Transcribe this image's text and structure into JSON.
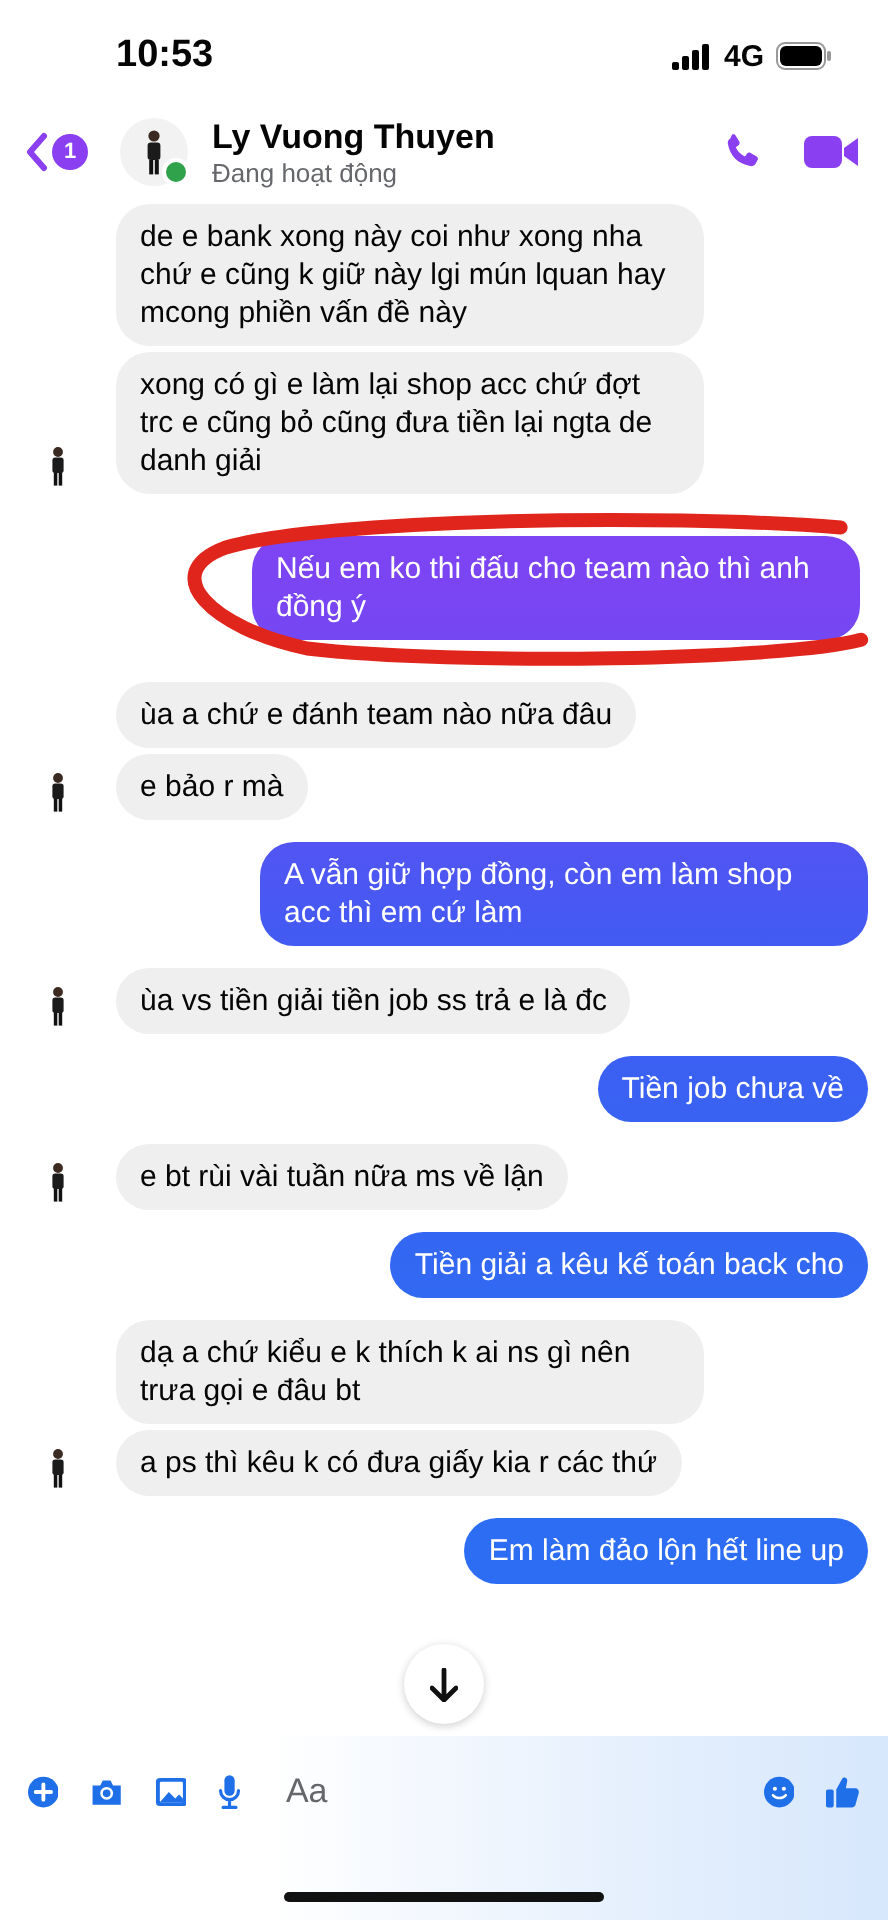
{
  "status_bar": {
    "time": "10:53",
    "network": "4G"
  },
  "header": {
    "back_badge": "1",
    "name": "Ly Vuong Thuyen",
    "status": "Đang hoạt động",
    "online": true
  },
  "messages": [
    {
      "kind": "incoming",
      "text": "de e bank xong này coi như xong nha chứ e cũng k giữ này lgi mún lquan hay mcong phiền vấn đề này",
      "avatar": false,
      "circled": false
    },
    {
      "kind": "incoming",
      "text": "xong có gì e làm lại shop acc chứ đợt trc e cũng bỏ cũng đưa tiền lại ngta de danh giải",
      "avatar": true,
      "circled": false
    },
    {
      "kind": "outgoing",
      "text": "Nếu em ko thi đấu cho team nào thì anh đồng ý",
      "avatar": false,
      "circled": true
    },
    {
      "kind": "incoming",
      "text": "ùa a chứ e đánh team nào nữa đâu",
      "avatar": false,
      "circled": false
    },
    {
      "kind": "incoming",
      "text": "e bảo r mà",
      "avatar": true,
      "circled": false
    },
    {
      "kind": "outgoing",
      "text": "A vẫn giữ hợp đồng, còn em làm shop acc thì em cứ làm",
      "avatar": false,
      "circled": false
    },
    {
      "kind": "incoming",
      "text": "ùa vs tiền giải tiền job ss trả e là đc",
      "avatar": true,
      "circled": false
    },
    {
      "kind": "outgoing",
      "text": "Tiền job chưa về",
      "avatar": false,
      "circled": false
    },
    {
      "kind": "incoming",
      "text": "e bt rùi vài tuần nữa ms về lận",
      "avatar": true,
      "circled": false
    },
    {
      "kind": "outgoing",
      "text": "Tiền giải a kêu kế toán back cho",
      "avatar": false,
      "circled": false
    },
    {
      "kind": "incoming",
      "text": "dạ a chứ kiểu e k thích k ai ns gì nên trưa gọi e đâu bt",
      "avatar": false,
      "circled": false
    },
    {
      "kind": "incoming",
      "text": "a ps thì kêu k có đưa giấy kia r các thứ",
      "avatar": true,
      "circled": false
    },
    {
      "kind": "outgoing",
      "text": "Em làm đảo lộn hết line up",
      "avatar": false,
      "circled": false
    }
  ],
  "composer": {
    "placeholder": "Aa"
  }
}
